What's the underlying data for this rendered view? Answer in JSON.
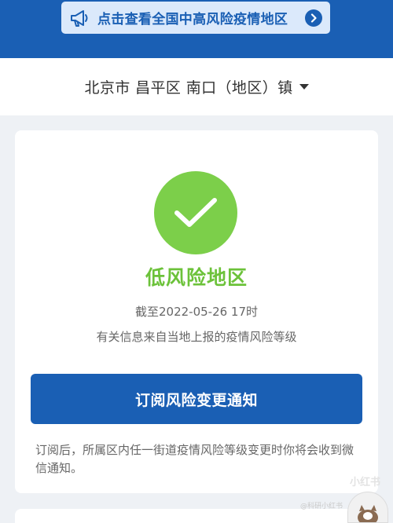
{
  "notice": {
    "text": "点击查看全国中高风险疫情地区",
    "megaphone_icon": "megaphone-icon",
    "arrow_icon": "chevron-right-icon"
  },
  "location": {
    "text": "北京市 昌平区 南口（地区）镇",
    "dropdown_icon": "caret-down-icon"
  },
  "status": {
    "icon": "checkmark-icon",
    "risk_level": "低风险地区",
    "as_of": "截至2022-05-26 17时",
    "source_note": "有关信息来自当地上报的疫情风险等级"
  },
  "subscribe": {
    "button_label": "订阅风险变更通知",
    "description": "订阅后，所属区内任一街道疫情风险等级变更时你将会收到微信通知。"
  },
  "watermark": {
    "brand": "小红书",
    "caption": "@科研小红书"
  },
  "colors": {
    "primary": "#1a5fb4",
    "low_risk_green": "#7ccf4a",
    "notice_bg": "#dbe9fb",
    "page_bg": "#eef1f5"
  }
}
